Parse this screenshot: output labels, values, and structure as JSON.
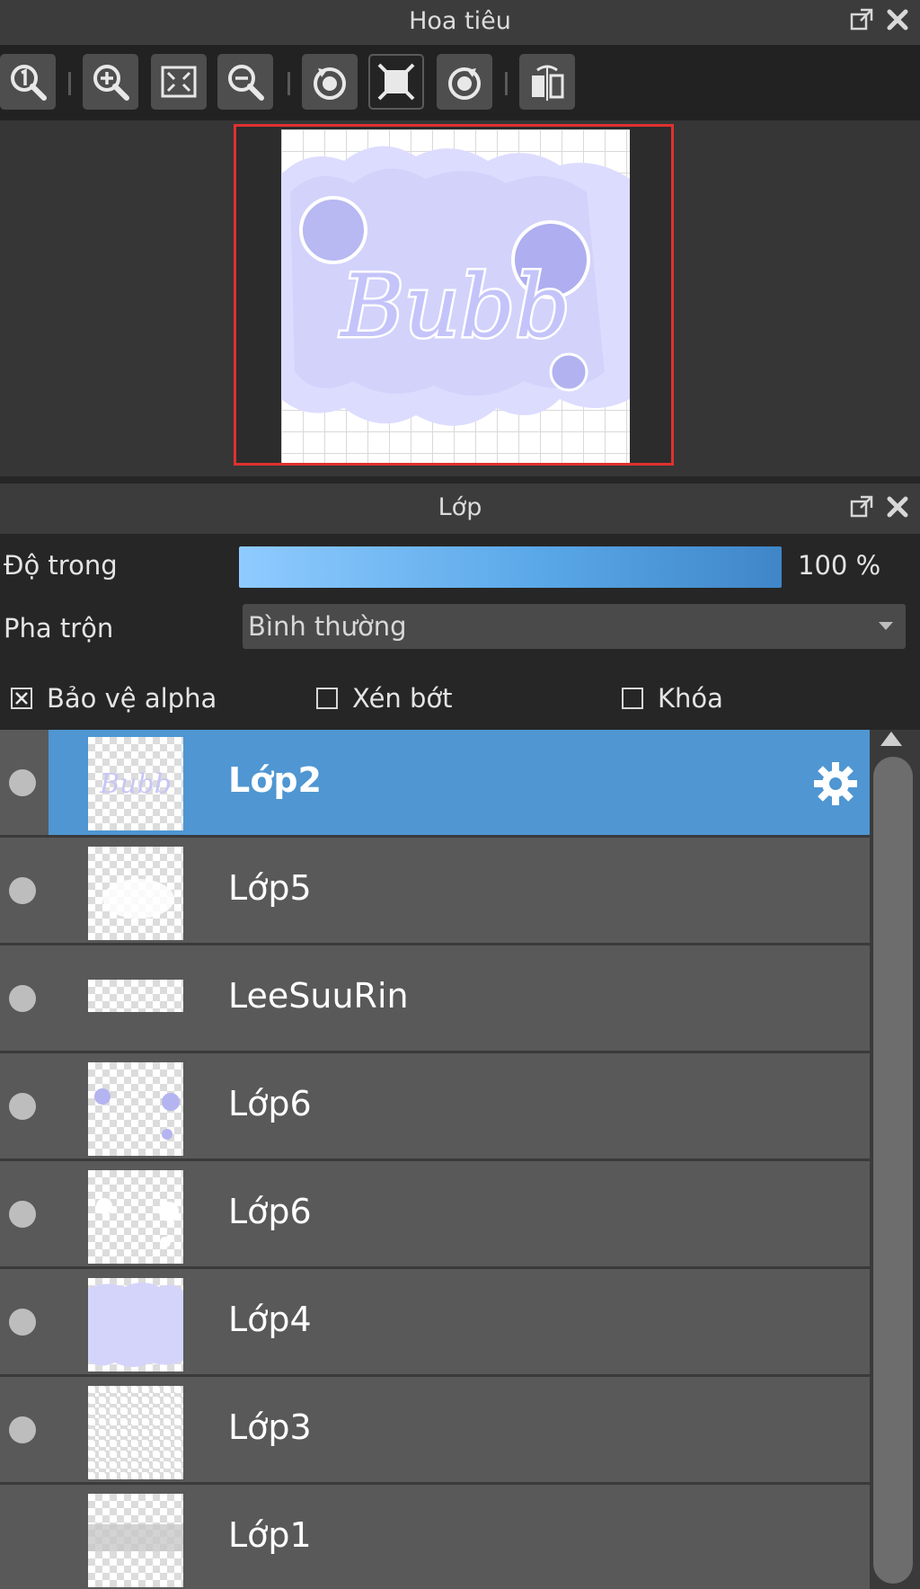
{
  "navigator": {
    "title": "Hoa tiêu",
    "undock_icon": "undock-icon",
    "close_icon": "close-icon",
    "toolbar": [
      {
        "name": "zoom-actual-size",
        "icon": "zoom-one-icon"
      },
      {
        "name": "zoom-in",
        "icon": "zoom-in-icon"
      },
      {
        "name": "fit-to-window",
        "icon": "fit-window-icon"
      },
      {
        "name": "zoom-out",
        "icon": "zoom-out-icon"
      },
      {
        "name": "rotate-left",
        "icon": "rotate-left-icon"
      },
      {
        "name": "reset-rotation",
        "icon": "reset-view-icon"
      },
      {
        "name": "rotate-right",
        "icon": "rotate-right-icon"
      },
      {
        "name": "flip-horizontal",
        "icon": "flip-horizontal-icon"
      }
    ],
    "preview_text": "Bubb",
    "frame_color": "#e03030"
  },
  "layers": {
    "title": "Lớp",
    "opacity_label": "Độ trong",
    "opacity_value": "100 %",
    "opacity_fraction": 1.0,
    "blend_label": "Pha trộn",
    "blend_value": "Bình thường",
    "protect_alpha": {
      "label": "Bảo vệ alpha",
      "checked": true
    },
    "clipping": {
      "label": "Xén bớt",
      "checked": false
    },
    "lock": {
      "label": "Khóa",
      "checked": false
    },
    "items": [
      {
        "name": "Lớp2",
        "selected": true,
        "has_settings": true
      },
      {
        "name": "Lớp5",
        "selected": false
      },
      {
        "name": "LeeSuuRin",
        "selected": false
      },
      {
        "name": "Lớp6",
        "selected": false
      },
      {
        "name": "Lớp6",
        "selected": false
      },
      {
        "name": "Lớp4",
        "selected": false
      },
      {
        "name": "Lớp3",
        "selected": false
      },
      {
        "name": "Lớp1",
        "selected": false
      }
    ],
    "accent_color": "#4f96d2"
  }
}
